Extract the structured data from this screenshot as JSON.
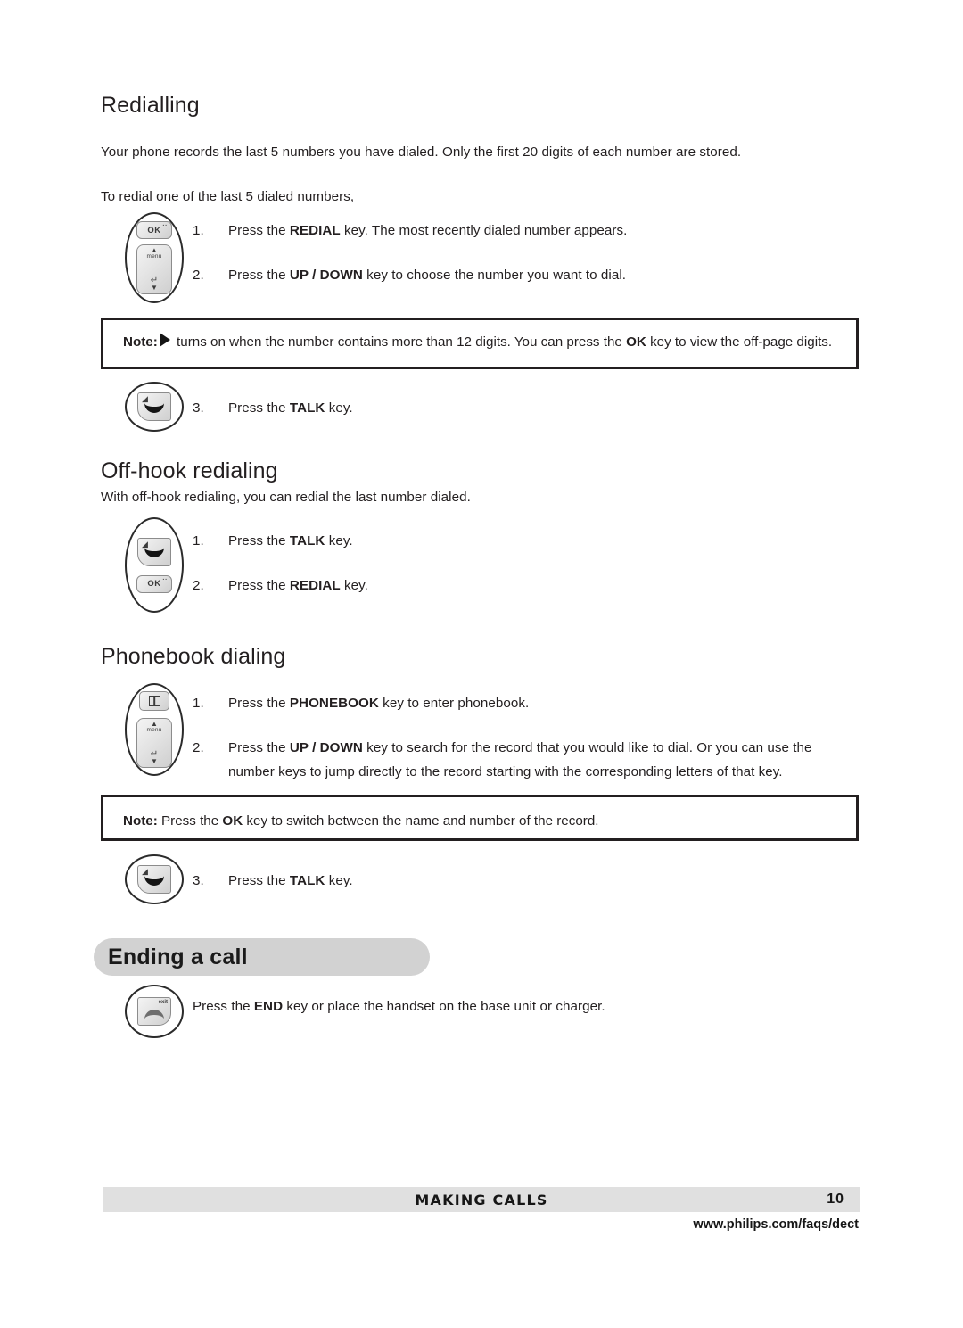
{
  "document": {
    "page_number": "10",
    "chapter": "MAKING CALLS",
    "url": "www.philips.com/faqs/dect"
  },
  "sections": {
    "redialling": {
      "heading": "Redialling",
      "intro": "Your phone records the last 5 numbers you have dialed.  Only the first 20 digits of each number are stored.",
      "lead_in": "To redial one of the last 5 dialed numbers,",
      "step1_num": "1.",
      "step1_pre": "Press the ",
      "step1_bold": "REDIAL",
      "step1_post": " key. The most recently dialed number appears.",
      "step2_num": "2.",
      "step2_pre": "Press the ",
      "step2_bold": "UP / DOWN",
      "step2_post": " key to choose the number you want to dial.",
      "note_label": "Note:",
      "note_pre": " turns on when the number contains more than 12 digits. You can press the ",
      "note_bold": "OK",
      "note_post": " key to view the off-page digits.",
      "step3_num": "3.",
      "step3_pre": "Press the ",
      "step3_bold": "TALK",
      "step3_post": " key."
    },
    "off_hook": {
      "heading": "Off-hook redialing",
      "intro": "With off-hook redialing, you can redial the last number dialed.",
      "step1_num": "1.",
      "step1_pre": "Press the ",
      "step1_bold": "TALK",
      "step1_post": " key.",
      "step2_num": "2.",
      "step2_pre": "Press the ",
      "step2_bold": "REDIAL",
      "step2_post": " key."
    },
    "phonebook": {
      "heading": "Phonebook dialing",
      "step1_num": "1.",
      "step1_pre": "Press the ",
      "step1_bold": "PHONEBOOK",
      "step1_post": " key to enter phonebook.",
      "step2_num": "2.",
      "step2_pre": "Press the ",
      "step2_bold": "UP / DOWN",
      "step2_post": " key to search for the record that you would like to dial.  Or you can use the number keys to jump directly to the record starting with the corresponding letters of that key.",
      "note_label": "Note:",
      "note_pre": " Press the ",
      "note_bold": "OK",
      "note_post": " key to switch between the name and number of the record.",
      "step3_num": "3.",
      "step3_pre": "Press the ",
      "step3_bold": "TALK",
      "step3_post": " key."
    },
    "ending_call": {
      "banner_title": "Ending a call",
      "instruction_pre": "Press the ",
      "instruction_bold": "END",
      "instruction_post": " key or place the handset on the base unit or charger."
    }
  },
  "key_icons": {
    "ok_label": "OK",
    "ok_mark": "··",
    "menu_label": "menu",
    "arrow_up": "▲",
    "arrow_down": "▼",
    "nav_mid_glyph": "↵",
    "speaker_glyph": "◢",
    "exit_label": "exit"
  },
  "colors": {
    "banner_gray": "#d2d2d2",
    "footer_gray": "#e0e0e0",
    "text": "#231f20",
    "note_border": "#231f20"
  }
}
